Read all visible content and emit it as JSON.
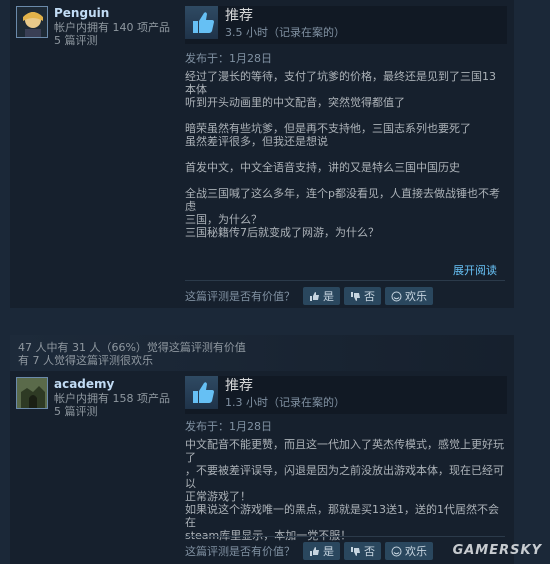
{
  "reviews": [
    {
      "user": {
        "name": "Penguin",
        "products": "帐户内拥有 140 项产品",
        "reviews": "5 篇评测"
      },
      "recommendation": "推荐",
      "hours": "3.5 小时（记录在案的）",
      "posted": "发布于：1月28日",
      "paragraphs": [
        "经过了漫长的等待，支付了坑爹的价格，最终还是见到了三国13本体",
        "听到开头动画里的中文配音，突然觉得都值了",
        "",
        "暗荣虽然有些坑爹，但是再不支持他，三国志系列也要死了",
        "虽然差评很多，但我还是想说",
        "",
        "首发中文，中文全语音支持，讲的又是特么三国中国历史",
        "",
        "全战三国喊了这么多年，连个p都没看见，人直接去做战锤也不考虑",
        "三国，为什么？",
        "三国秘籍传7后就变成了网游，为什么？"
      ],
      "expand": "展开阅读",
      "helpful_q": "这篇评测是否有价值？",
      "yes": "是",
      "no": "否",
      "funny": "欢乐"
    },
    {
      "help_line1": "47 人中有 31 人（66%）觉得这篇评测有价值",
      "help_line2": "有 7 人觉得这篇评测很欢乐",
      "user": {
        "name": "academy",
        "products": "帐户内拥有 158 项产品",
        "reviews": "5 篇评测"
      },
      "recommendation": "推荐",
      "hours": "1.3 小时（记录在案的）",
      "posted": "发布于：1月28日",
      "paragraphs": [
        "中文配音不能更赞，而且这一代加入了英杰传模式，感觉上更好玩了",
        "，不要被差评误导，闪退是因为之前没放出游戏本体，现在已经可以",
        "正常游戏了！",
        "如果说这个游戏唯一的黑点，那就是买13送1，送的1代居然不会在",
        "steam库里显示，本加一党不服！"
      ],
      "helpful_q": "这篇评测是否有价值？",
      "yes": "是",
      "no": "否",
      "funny": "欢乐"
    }
  ],
  "watermark": "GAMERSKY",
  "colors": {
    "background": "#1b2838",
    "link": "#67c1f5",
    "button": "#2a475e"
  },
  "icons": {
    "thumb": "thumbs-up-icon",
    "down": "thumbs-down-icon",
    "funny": "smiley-icon"
  }
}
